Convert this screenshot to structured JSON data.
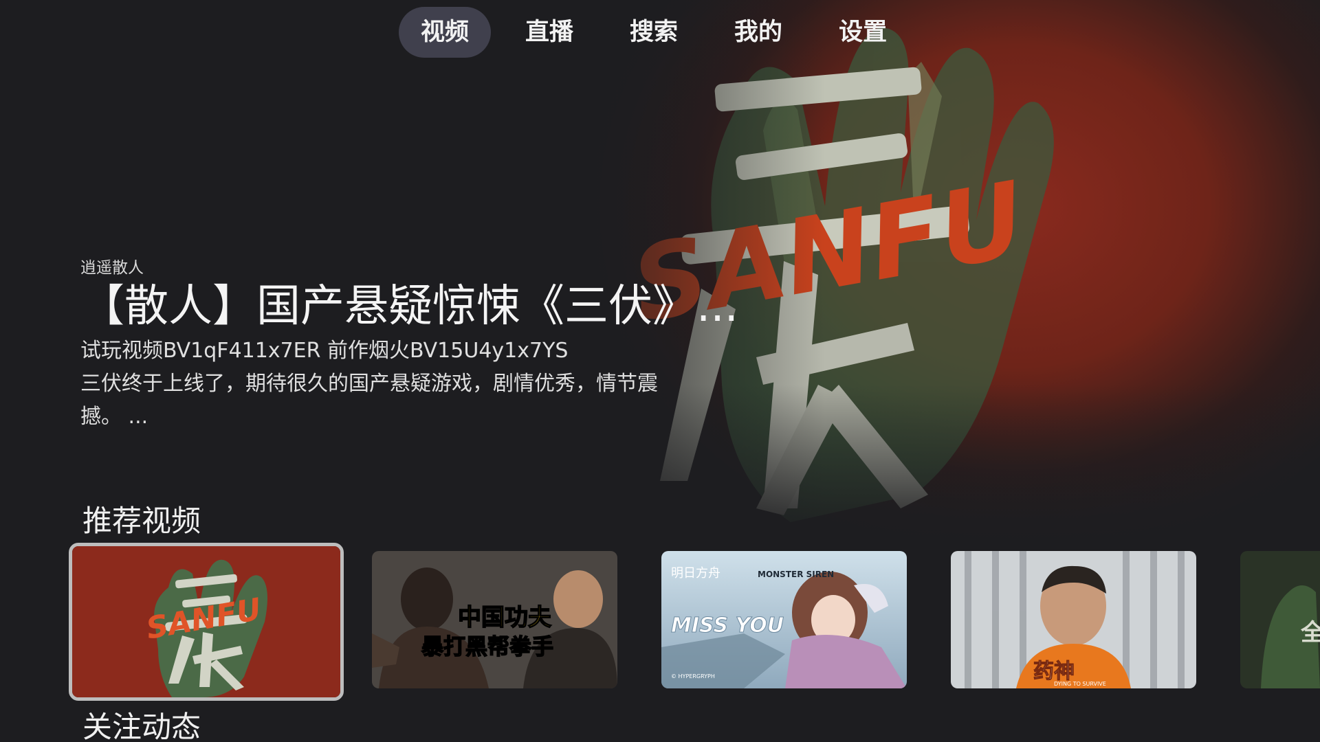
{
  "nav": {
    "tabs": [
      {
        "label": "视频",
        "active": true
      },
      {
        "label": "直播",
        "active": false
      },
      {
        "label": "搜索",
        "active": false
      },
      {
        "label": "我的",
        "active": false
      },
      {
        "label": "设置",
        "active": false
      }
    ]
  },
  "featured": {
    "author": "逍遥散人",
    "title": "【散人】国产悬疑惊悚《三伏》...",
    "desc_line1": "试玩视频BV1qF411x7ER 前作烟火BV15U4y1x7YS",
    "desc_line2": "三伏终于上线了，期待很久的国产悬疑游戏，剧情优秀，情节震",
    "desc_line3": "撼。 ...",
    "art_text_cn": "三伏",
    "art_text_en": "SANFU"
  },
  "sections": {
    "recommended": "推荐视频",
    "following": "关注动态"
  },
  "cards": [
    {
      "thumb_text_cn": "三伏",
      "thumb_text_en": "SANFU",
      "focused": true
    },
    {
      "thumb_text_line1": "中国功夫",
      "thumb_text_line2": "暴打黑帮拳手",
      "focused": false
    },
    {
      "thumb_text_brand": "明日方舟",
      "thumb_text_sub": "MONSTER SIREN",
      "thumb_text_main": "MISS YOU",
      "thumb_text_foot": "© HYPERGRYPH",
      "focused": false
    },
    {
      "thumb_text_main": "药神",
      "thumb_text_sub": "DYING TO SURVIVE",
      "focused": false
    },
    {
      "thumb_text_main": "全",
      "focused": false
    }
  ],
  "colors": {
    "background": "#1d1d20",
    "hero_red": "#8a2a1e",
    "accent_orange": "#d4461c",
    "nav_active_bg": "#464656"
  }
}
